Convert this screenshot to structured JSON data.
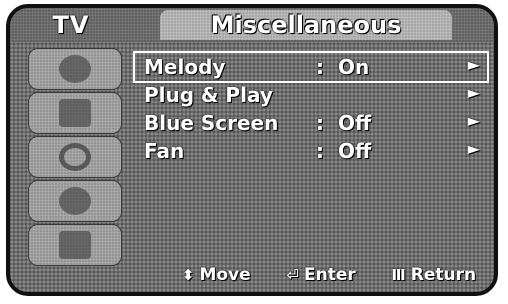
{
  "header": {
    "left_title": "TV",
    "title": "Miscellaneous"
  },
  "sidebar": {
    "icons": [
      {
        "name": "picture-icon"
      },
      {
        "name": "sound-icon"
      },
      {
        "name": "channel-icon"
      },
      {
        "name": "setup-icon"
      },
      {
        "name": "input-icon"
      },
      {
        "name": "misc-icon"
      }
    ]
  },
  "menu": {
    "items": [
      {
        "label": "Melody",
        "colon": ":",
        "value": "On",
        "arrow": "►",
        "selected": true
      },
      {
        "label": "Plug & Play",
        "colon": "",
        "value": "",
        "arrow": "►",
        "selected": false
      },
      {
        "label": "Blue Screen",
        "colon": ":",
        "value": "Off",
        "arrow": "►",
        "selected": false
      },
      {
        "label": "Fan",
        "colon": ":",
        "value": "Off",
        "arrow": "►",
        "selected": false
      }
    ]
  },
  "footer": {
    "move": {
      "icon": "⬍",
      "label": "Move"
    },
    "enter": {
      "icon": "⏎",
      "label": "Enter"
    },
    "return": {
      "icon": "Ⅲ",
      "label": "Return"
    }
  }
}
